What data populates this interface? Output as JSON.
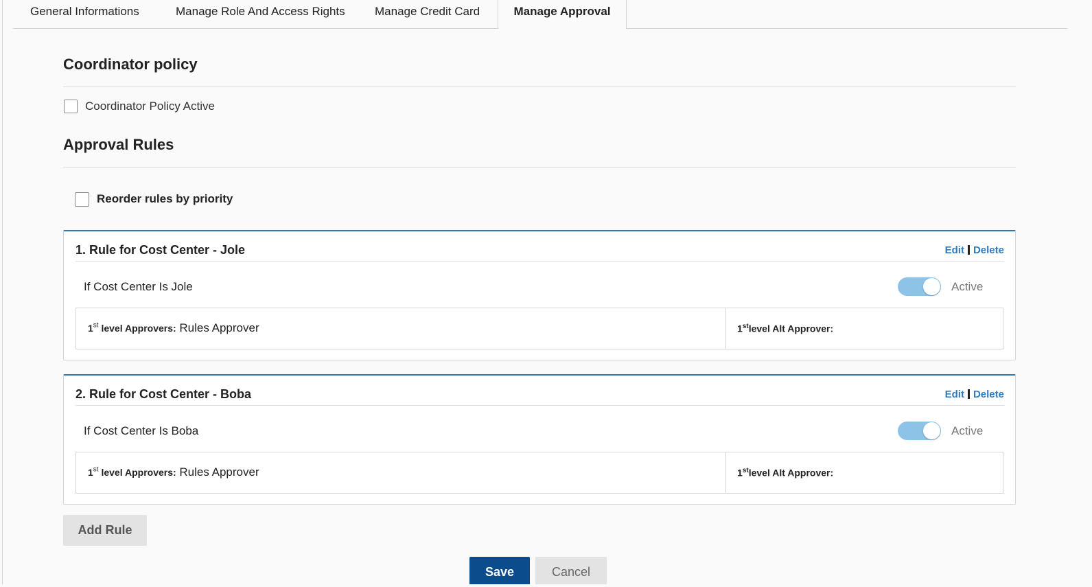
{
  "tabs": [
    {
      "label": "General Informations"
    },
    {
      "label": "Manage Role And Access Rights"
    },
    {
      "label": "Manage Credit Card"
    },
    {
      "label": "Manage Approval"
    }
  ],
  "coordinator": {
    "title": "Coordinator policy",
    "checkbox_label": "Coordinator Policy Active",
    "checked": false
  },
  "approval": {
    "title": "Approval Rules",
    "reorder_label": "Reorder rules by priority"
  },
  "rules": [
    {
      "title": "1. Rule for Cost Center - Jole",
      "edit": "Edit",
      "delete": "Delete",
      "condition": "If Cost Center Is Jole",
      "status": "Active",
      "approver_level": "1",
      "approver_sup": "st",
      "approver_key": " level Approvers:",
      "approver_value": " Rules Approver",
      "alt_level": "1",
      "alt_sup": "st",
      "alt_key": "level Alt Approver:"
    },
    {
      "title": "2. Rule for Cost Center - Boba",
      "edit": "Edit",
      "delete": "Delete",
      "condition": "If Cost Center Is Boba",
      "status": "Active",
      "approver_level": "1",
      "approver_sup": "st",
      "approver_key": " level Approvers:",
      "approver_value": " Rules Approver",
      "alt_level": "1",
      "alt_sup": "st",
      "alt_key": "level Alt Approver:"
    }
  ],
  "buttons": {
    "add_rule": "Add Rule",
    "save": "Save",
    "cancel": "Cancel"
  },
  "colors": {
    "accent": "#2d78b3",
    "link": "#2f7bbf",
    "primary_button": "#0b4d8c",
    "toggle_on": "#8ec3e8"
  }
}
